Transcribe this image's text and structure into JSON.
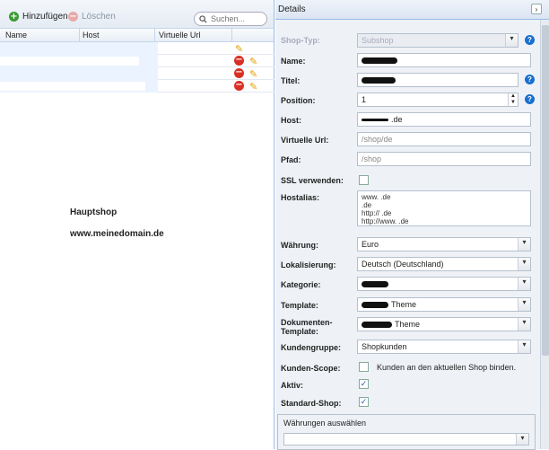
{
  "toolbar": {
    "add_label": "Hinzufügen",
    "delete_label": "Löschen",
    "search_placeholder": "Suchen..."
  },
  "grid": {
    "columns": [
      "Name",
      "Host",
      "Virtuelle Url"
    ]
  },
  "note": {
    "line1": "Hauptshop",
    "line2": "www.meinedomain.de"
  },
  "details": {
    "title": "Details",
    "fields": {
      "shop_typ": {
        "label": "Shop-Typ:",
        "value": "Subshop"
      },
      "name": {
        "label": "Name:",
        "value": ""
      },
      "titel": {
        "label": "Titel:",
        "value": ""
      },
      "position": {
        "label": "Position:",
        "value": "1"
      },
      "host": {
        "label": "Host:",
        "value": ".de"
      },
      "virtuelle_url": {
        "label": "Virtuelle Url:",
        "placeholder": "/shop/de"
      },
      "pfad": {
        "label": "Pfad:",
        "placeholder": "/shop"
      },
      "ssl": {
        "label": "SSL verwenden:"
      },
      "hostalias": {
        "label": "Hostalias:",
        "lines": [
          "www.        .de",
          "       .de",
          "http://        .de",
          "http://www.        .de"
        ]
      },
      "waehrung": {
        "label": "Währung:",
        "value": "Euro"
      },
      "lokalisierung": {
        "label": "Lokalisierung:",
        "value": "Deutsch (Deutschland)"
      },
      "kategorie": {
        "label": "Kategorie:",
        "value": ""
      },
      "template": {
        "label": "Template:",
        "value": "Theme"
      },
      "dokumenten_template": {
        "label_line1": "Dokumenten-",
        "label_line2": "Template:",
        "value": "Theme"
      },
      "kundengruppe": {
        "label": "Kundengruppe:",
        "value": "Shopkunden"
      },
      "kunden_scope": {
        "label": "Kunden-Scope:",
        "text": "Kunden an den aktuellen Shop binden."
      },
      "aktiv": {
        "label": "Aktiv:",
        "checked": true
      },
      "standard_shop": {
        "label": "Standard-Shop:",
        "checked": true
      }
    },
    "waehrungen_legend": "Währungen auswählen"
  }
}
